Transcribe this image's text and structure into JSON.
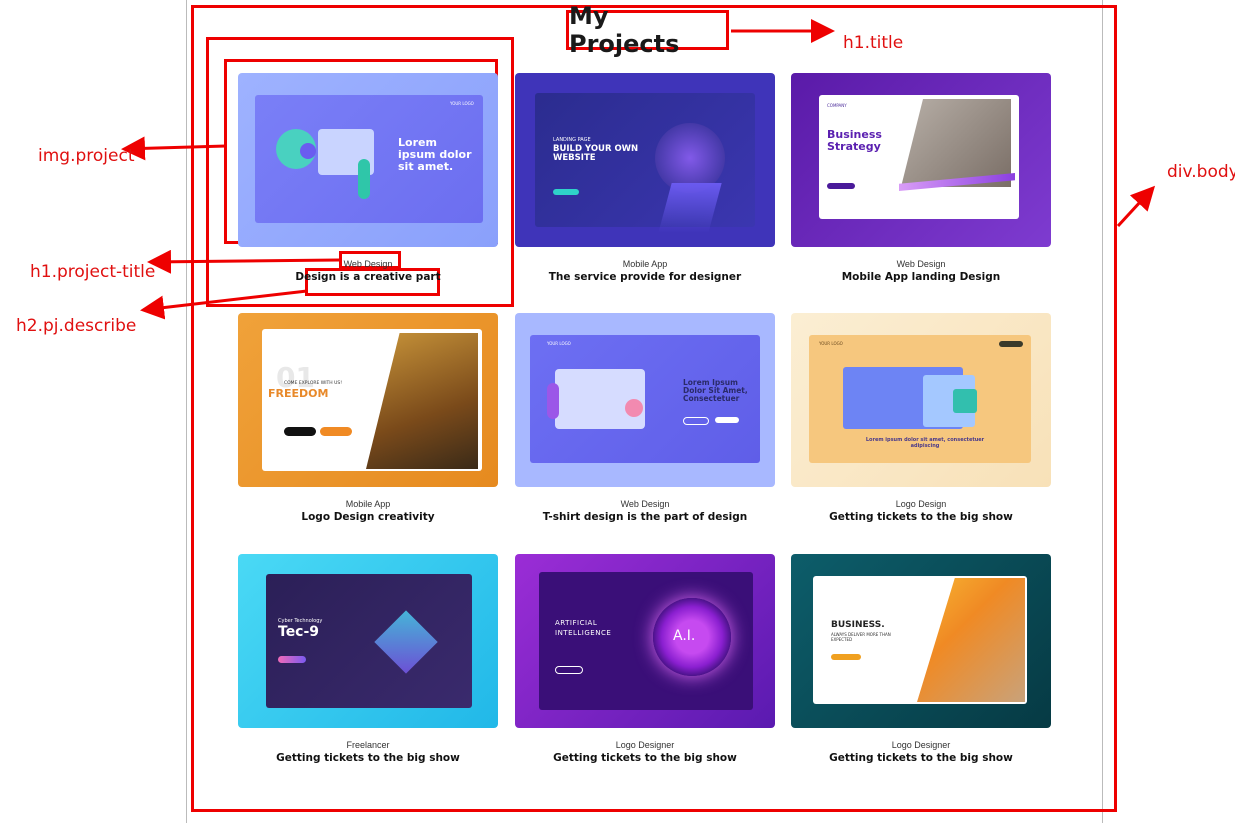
{
  "page": {
    "title": "My Projects"
  },
  "annotations": {
    "h1_title": "h1.title",
    "img_project": "img.project",
    "div_body": "div.body",
    "h1_project_title": "h1.project-title",
    "h2_pj_describe": "h2.pj.describe"
  },
  "projects": [
    {
      "category": "Web Design",
      "description": "Design is a creative part",
      "thumb_text": "Lorem ipsum dolor sit amet.",
      "thumb_small": "YOUR LOGO"
    },
    {
      "category": "Mobile App",
      "description": "The service provide for designer",
      "thumb_text": "BUILD YOUR OWN WEBSITE",
      "thumb_small": "LANDING PAGE"
    },
    {
      "category": "Web Design",
      "description": "Mobile App landing Design",
      "thumb_text": "Business Strategy",
      "thumb_small": "COMPANY"
    },
    {
      "category": "Mobile App",
      "description": "Logo Design creativity",
      "thumb_text": "FREEDOM",
      "thumb_small": "COME EXPLORE WITH US!"
    },
    {
      "category": "Web Design",
      "description": "T-shirt design is the part of design",
      "thumb_text": "Lorem Ipsum Dolor Sit Amet, Consectetuer",
      "thumb_small": "YOUR LOGO"
    },
    {
      "category": "Logo Design",
      "description": "Getting tickets to the big show",
      "thumb_text": "Lorem ipsum dolor sit amet, consectetuer adipiscing",
      "thumb_small": "YOUR LOGO"
    },
    {
      "category": "Freelancer",
      "description": "Getting tickets to the big show",
      "thumb_text": "Tec-9",
      "thumb_small": "Cyber Technology"
    },
    {
      "category": "Logo Designer",
      "description": "Getting tickets to the big show",
      "thumb_text": "A.I.",
      "thumb_small": "ARTIFICIAL INTELLIGENCE"
    },
    {
      "category": "Logo Designer",
      "description": "Getting tickets to the big show",
      "thumb_text": "BUSINESS.",
      "thumb_small": "ALWAYS DELIVER MORE THAN EXPECTED"
    }
  ],
  "colors": {
    "annotation": "#ee0000",
    "accent_purple": "#6a3fd0"
  }
}
